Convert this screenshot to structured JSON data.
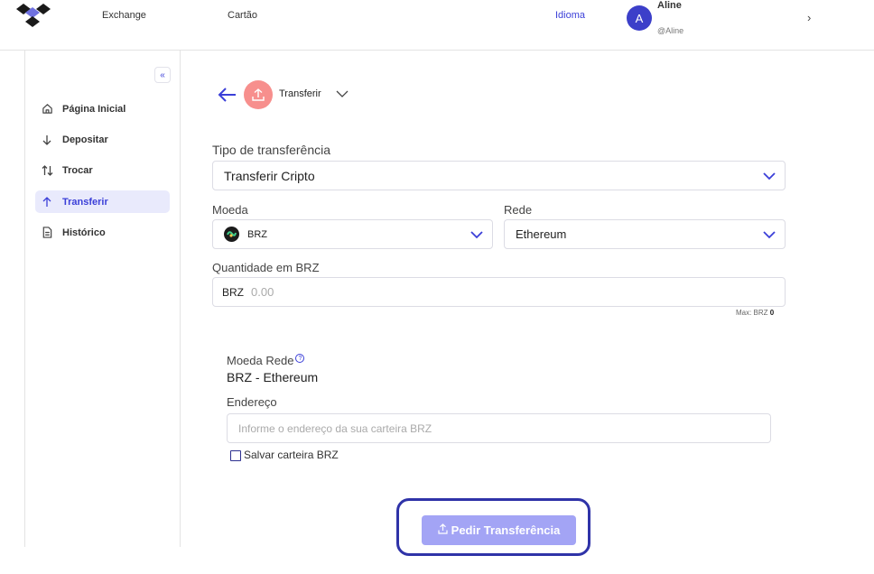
{
  "header": {
    "nav": [
      "Exchange",
      "Cartão"
    ],
    "language": "Idioma",
    "user": {
      "initial": "A",
      "name": "Aline",
      "handle": "@Aline"
    }
  },
  "sidebar": {
    "collapse_icon": "double-chevron-left-icon",
    "items": [
      {
        "label": "Página Inicial",
        "icon": "home-icon",
        "active": false
      },
      {
        "label": "Depositar",
        "icon": "arrow-down-icon",
        "active": false
      },
      {
        "label": "Trocar",
        "icon": "swap-icon",
        "active": false
      },
      {
        "label": "Transferir",
        "icon": "arrow-up-icon",
        "active": true
      },
      {
        "label": "Histórico",
        "icon": "document-icon",
        "active": false
      }
    ]
  },
  "main": {
    "title": "Transferir",
    "transfer_type": {
      "label": "Tipo de transferência",
      "value": "Transferir Cripto"
    },
    "currency": {
      "label": "Moeda",
      "value": "BRZ"
    },
    "network": {
      "label": "Rede",
      "value": "Ethereum"
    },
    "quantity": {
      "label": "Quantidade em BRZ",
      "prefix": "BRZ",
      "placeholder": "0.00",
      "max_label": "Max: BRZ",
      "max_value": "0"
    },
    "network_coin": {
      "label": "Moeda Rede",
      "help": "?",
      "value": "BRZ - Ethereum"
    },
    "address": {
      "label": "Endereço",
      "placeholder": "Informe o endereço da sua carteira BRZ"
    },
    "save_wallet": {
      "label": "Salvar carteira BRZ",
      "checked": false
    },
    "submit_label": "Pedir Transferência"
  },
  "colors": {
    "accent": "#3b3fd8",
    "transfer_icon_bg": "#f78f8d",
    "button_bg": "#a3a4f5",
    "highlight": "#2f33a8"
  }
}
